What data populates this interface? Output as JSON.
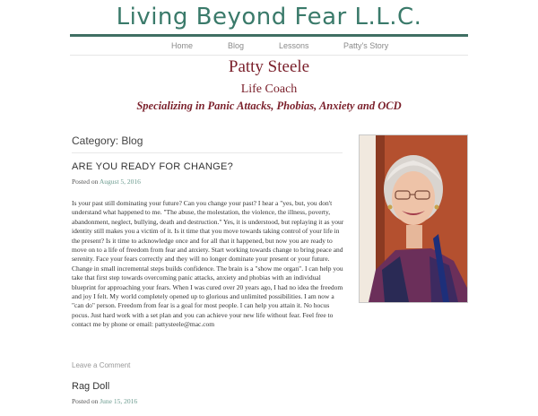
{
  "site": {
    "title": "Living Beyond Fear L.L.C."
  },
  "nav": {
    "items": [
      "Home",
      "Blog",
      "Lessons",
      "Patty's Story"
    ]
  },
  "header": {
    "name": "Patty Steele",
    "role": "Life Coach",
    "specialty": "Specializing in Panic Attacks, Phobias, Anxiety and OCD"
  },
  "main": {
    "category_label": "Category: Blog",
    "posts": [
      {
        "title": "ARE YOU READY FOR CHANGE?",
        "posted_prefix": "Posted on",
        "date": "August 5, 2016",
        "body": "Is your past still dominating your future? Can you change your past? I hear a \"yes, but, you don't understand what happened to me. \"The abuse, the molestation, the violence, the illness, poverty, abandonment, neglect, bullying, death and destruction.\"  Yes, it is understood, but replaying it as your identity still makes you a victim of it. Is it time that you move towards taking control of your life in the present? Is it time to acknowledge once and for all that it happened, but now you are ready to move on to a life of freedom from fear and anxiety. Start working towards change to bring  peace and serenity. Face your fears correctly and they will no longer dominate your present or your future. Change in small incremental steps builds confidence. The brain is a \"show me organ\". I can help you take that first step towards overcoming panic attacks, anxiety and phobias with an individual blueprint for approaching your fears.  When I was cured over 20 years ago, I had no idea the freedom and joy I felt.  My world completely opened up to glorious and unlimited possibilities.   I am now a \"can do\" person.   Freedom from fear is a goal for most people.  I can help you attain it.  No hocus pocus.  Just hard work with a set plan and you can achieve your new life without fear.  Feel free to contact me by phone or email: pattysteele@mac.com",
        "comment_link": "Leave a Comment"
      },
      {
        "title": "Rag Doll",
        "posted_prefix": "Posted on",
        "date": "June 15, 2016"
      }
    ]
  },
  "sidebar": {
    "photo_icon": "portrait-photo"
  },
  "colors": {
    "title": "#3a7a6a",
    "accent_rule": "#3f6f63",
    "header_text": "#7a1f2a",
    "date_link": "#6a9a8e"
  }
}
